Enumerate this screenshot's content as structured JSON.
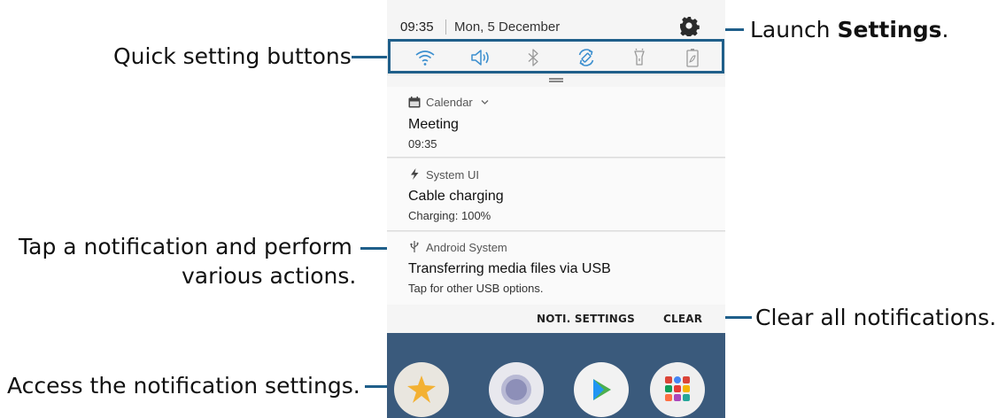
{
  "status_bar": {
    "time": "09:35",
    "date": "Mon, 5 December",
    "settings_icon": "gear-icon"
  },
  "quick_settings": [
    {
      "name": "Wi-Fi",
      "icon": "wifi-icon",
      "state": "on"
    },
    {
      "name": "Sound",
      "icon": "sound-icon",
      "state": "on"
    },
    {
      "name": "Bluetooth",
      "icon": "bluetooth-icon",
      "state": "off"
    },
    {
      "name": "Auto rotate",
      "icon": "rotate-icon",
      "state": "on"
    },
    {
      "name": "Flashlight",
      "icon": "flashlight-icon",
      "state": "off"
    },
    {
      "name": "Power saving",
      "icon": "battery-icon",
      "state": "off"
    }
  ],
  "notifications": [
    {
      "app": "Calendar",
      "icon": "calendar-icon",
      "expand_icon": "chevron-down-icon",
      "title": "Meeting",
      "text": "09:35"
    },
    {
      "app": "System UI",
      "icon": "bolt-icon",
      "title": "Cable charging",
      "text": "Charging: 100%"
    },
    {
      "app": "Android System",
      "icon": "usb-icon",
      "title": "Transferring media files via USB",
      "text": "Tap for other USB options."
    }
  ],
  "actions": {
    "noti_settings": "NOTI. SETTINGS",
    "clear": "CLEAR"
  },
  "callouts": {
    "quick_settings": "Quick setting buttons",
    "launch_prefix": "Launch ",
    "launch_bold": "Settings",
    "launch_suffix": ".",
    "tap_line1": "Tap a notification and perform",
    "tap_line2": "various actions.",
    "clear_all": "Clear all notifications.",
    "access_settings": "Access the notification settings."
  },
  "colors": {
    "accent": "#1f5f8a",
    "quick_setting_active": "#3c8fcf",
    "quick_setting_inactive": "#9a9a9a"
  }
}
